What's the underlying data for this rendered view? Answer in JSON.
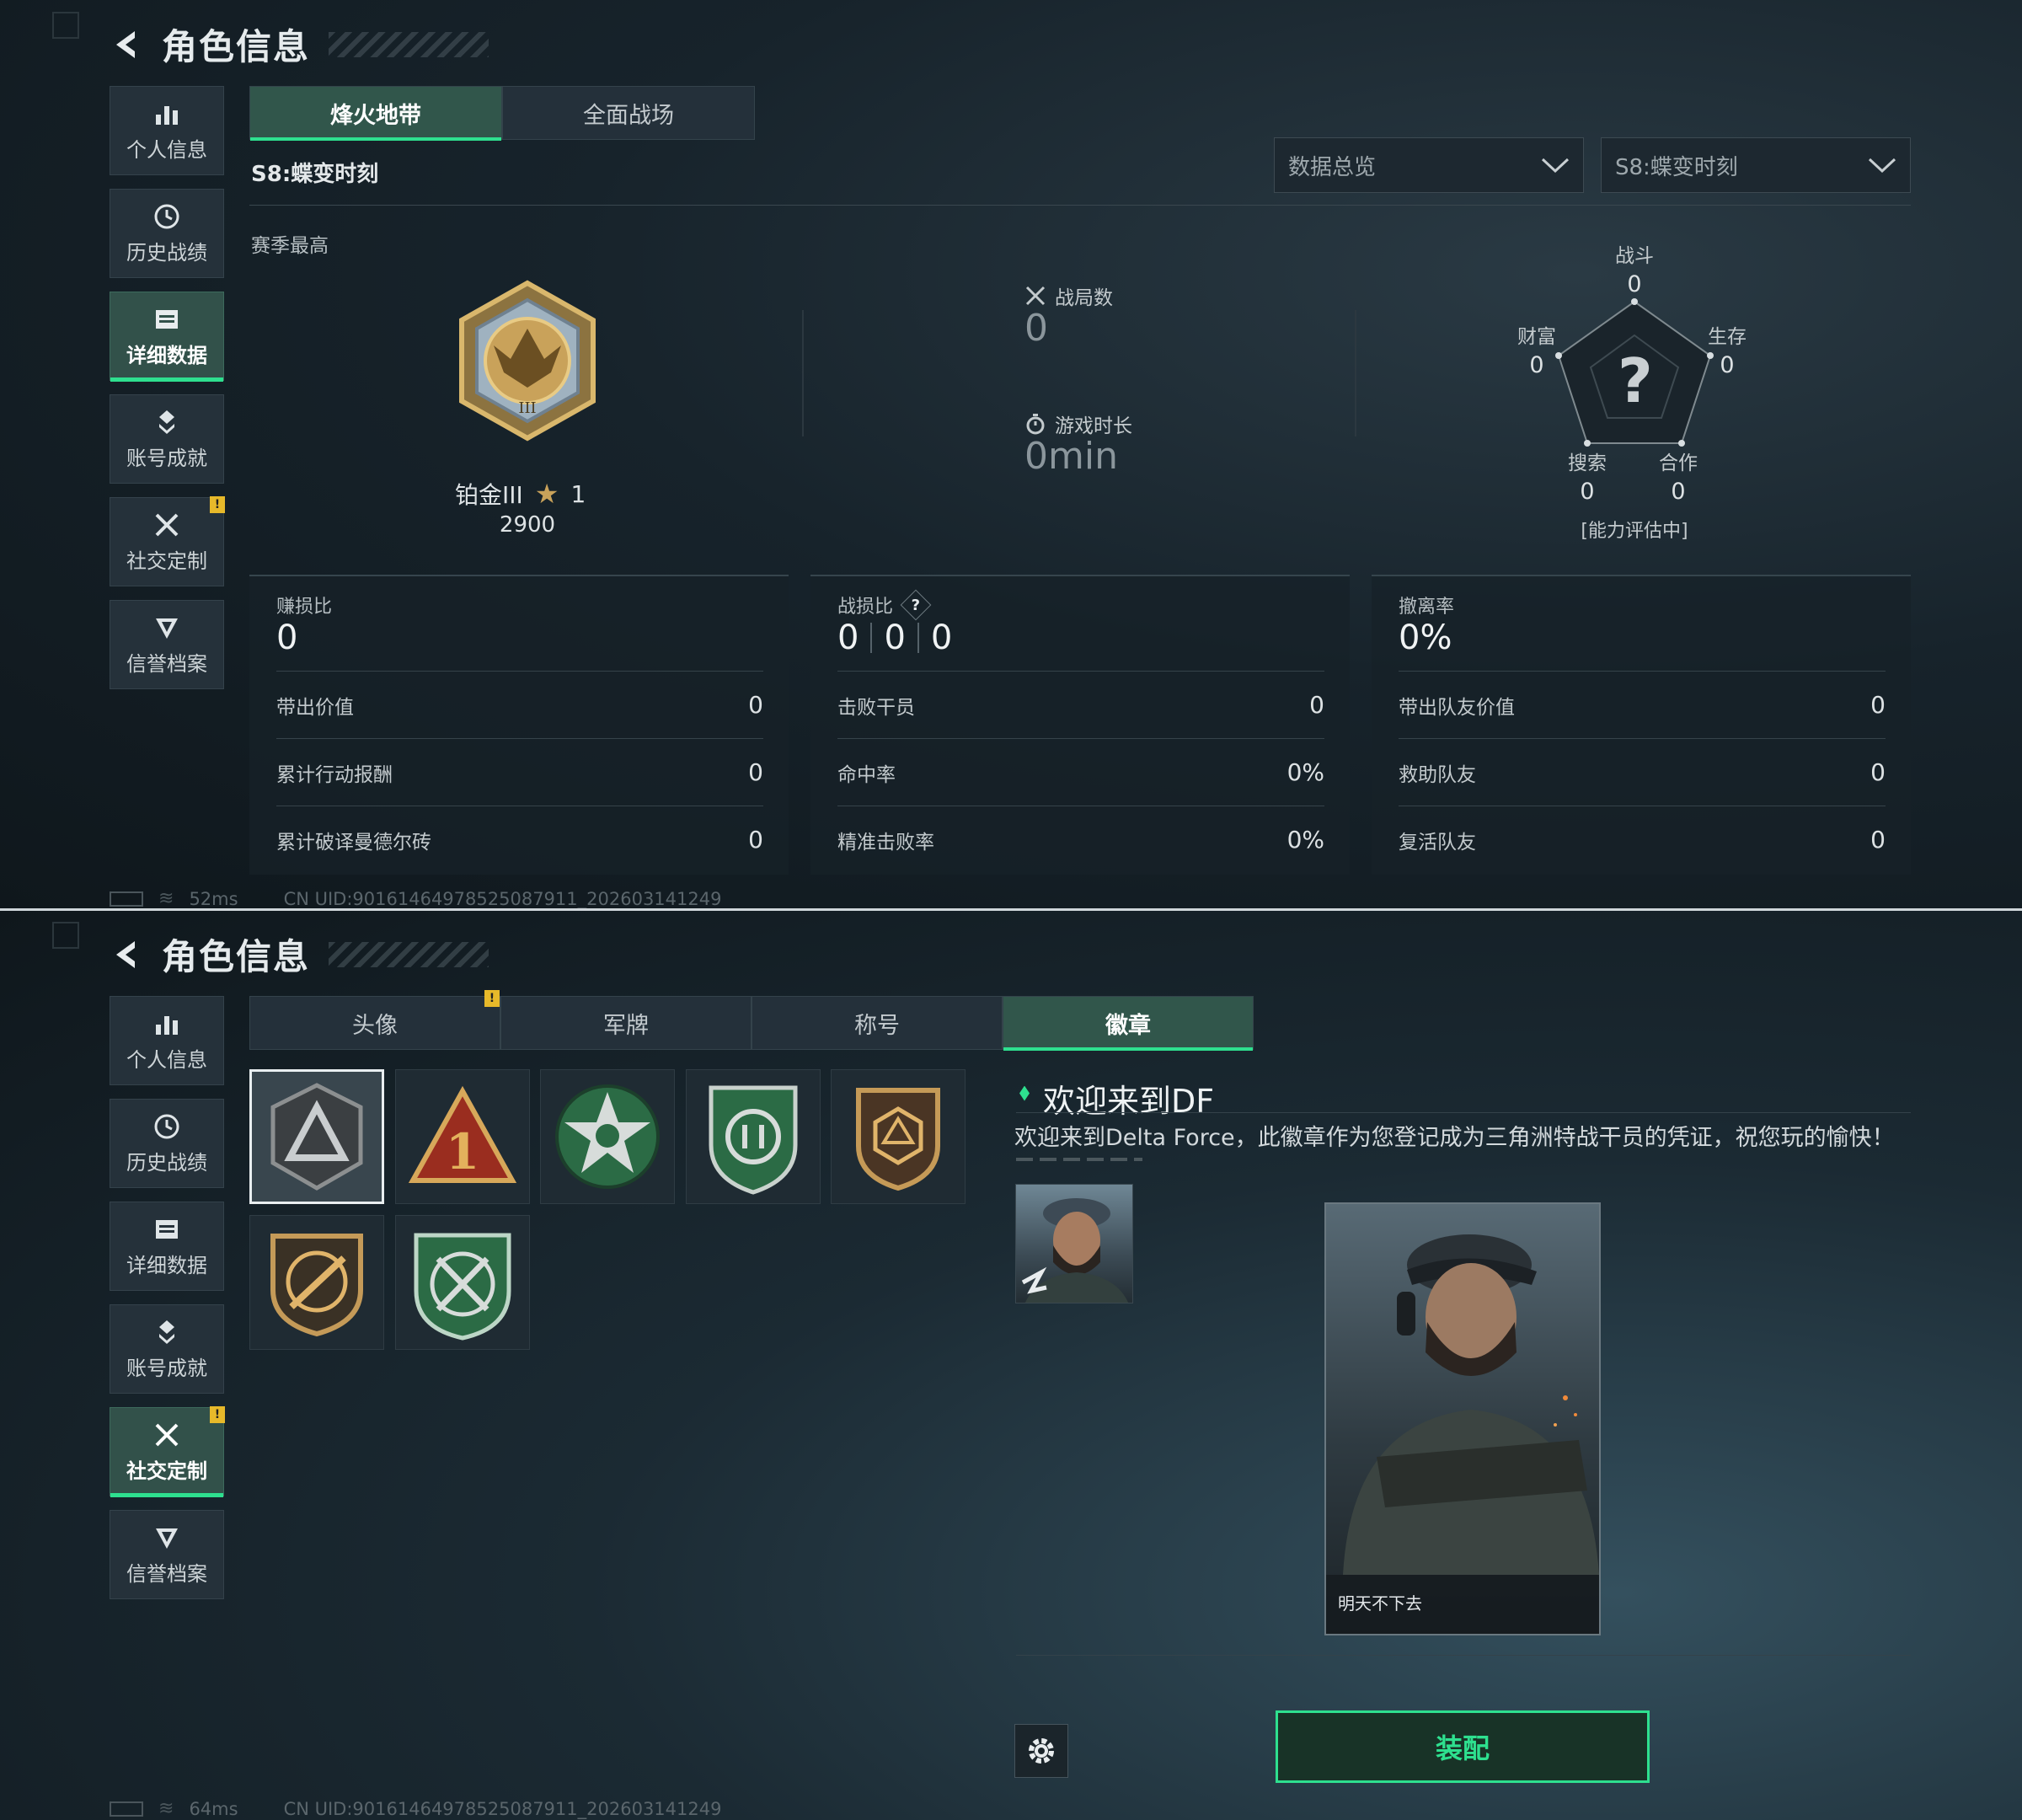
{
  "screen1": {
    "title": "角色信息",
    "sidebar": [
      {
        "label": "个人信息",
        "icon": "bar-chart-icon"
      },
      {
        "label": "历史战绩",
        "icon": "clock-icon"
      },
      {
        "label": "详细数据",
        "icon": "folder-icon",
        "active": true
      },
      {
        "label": "账号成就",
        "icon": "achievement-icon"
      },
      {
        "label": "社交定制",
        "icon": "tools-icon",
        "badge": "!"
      },
      {
        "label": "信誉档案",
        "icon": "shield-icon"
      }
    ],
    "tabs": [
      "烽火地带",
      "全面战场"
    ],
    "season_label": "S8:蝶变时刻",
    "dropdown1": "数据总览",
    "dropdown2": "S8:蝶变时刻",
    "season_best_label": "赛季最高",
    "rank": {
      "name": "铂金III",
      "stars": "1",
      "score": "2900"
    },
    "matches": {
      "label": "战局数",
      "value": "0"
    },
    "playtime": {
      "label": "游戏时长",
      "value": "0min"
    },
    "radar": {
      "combat": {
        "label": "战斗",
        "value": "0"
      },
      "survival": {
        "label": "生存",
        "value": "0"
      },
      "wealth": {
        "label": "财富",
        "value": "0"
      },
      "search": {
        "label": "搜索",
        "value": "0"
      },
      "coop": {
        "label": "合作",
        "value": "0"
      },
      "center_mark": "?",
      "status": "[能力评估中]"
    },
    "panel1": {
      "header": "赚损比",
      "value": "0",
      "rows": [
        {
          "label": "带出价值",
          "value": "0"
        },
        {
          "label": "累计行动报酬",
          "value": "0"
        },
        {
          "label": "累计破译曼德尔砖",
          "value": "0"
        }
      ]
    },
    "panel2": {
      "header": "战损比",
      "help": "?",
      "values": [
        "0",
        "0",
        "0"
      ],
      "rows": [
        {
          "label": "击败干员",
          "value": "0"
        },
        {
          "label": "命中率",
          "value": "0%"
        },
        {
          "label": "精准击败率",
          "value": "0%"
        }
      ]
    },
    "panel3": {
      "header": "撤离率",
      "value": "0%",
      "rows": [
        {
          "label": "带出队友价值",
          "value": "0"
        },
        {
          "label": "救助队友",
          "value": "0"
        },
        {
          "label": "复活队友",
          "value": "0"
        }
      ]
    },
    "ping": "52ms",
    "uid": "CN UID:90161464978525087911_202603141249"
  },
  "screen2": {
    "title": "角色信息",
    "sidebar": [
      {
        "label": "个人信息",
        "icon": "bar-chart-icon"
      },
      {
        "label": "历史战绩",
        "icon": "clock-icon"
      },
      {
        "label": "详细数据",
        "icon": "folder-icon"
      },
      {
        "label": "账号成就",
        "icon": "achievement-icon"
      },
      {
        "label": "社交定制",
        "icon": "tools-icon",
        "active": true,
        "badge": "!"
      },
      {
        "label": "信誉档案",
        "icon": "shield-icon"
      }
    ],
    "tabs": [
      {
        "label": "头像",
        "badge": "!"
      },
      {
        "label": "军牌"
      },
      {
        "label": "称号"
      },
      {
        "label": "徽章",
        "active": true
      }
    ],
    "badges": [
      "delta-triangle-badge-icon",
      "number-one-triangle-badge-icon",
      "green-star-badge-icon",
      "green-shield-badge-icon",
      "gold-hexagon-badge-icon",
      "rifle-badge-icon",
      "crossed-swords-badge-icon"
    ],
    "detail": {
      "title": "欢迎来到DF",
      "desc": "欢迎来到Delta Force，此徽章作为您登记成为三角洲特战干员的凭证，祝您玩的愉快！",
      "card_name": "明天不下去"
    },
    "equip_button": "装配",
    "ping": "64ms",
    "uid": "CN UID:90161464978525087911_202603141249"
  },
  "colors": {
    "accent": "#2ee08f",
    "warning": "#e7b92a",
    "gold": "#c9a25a"
  }
}
